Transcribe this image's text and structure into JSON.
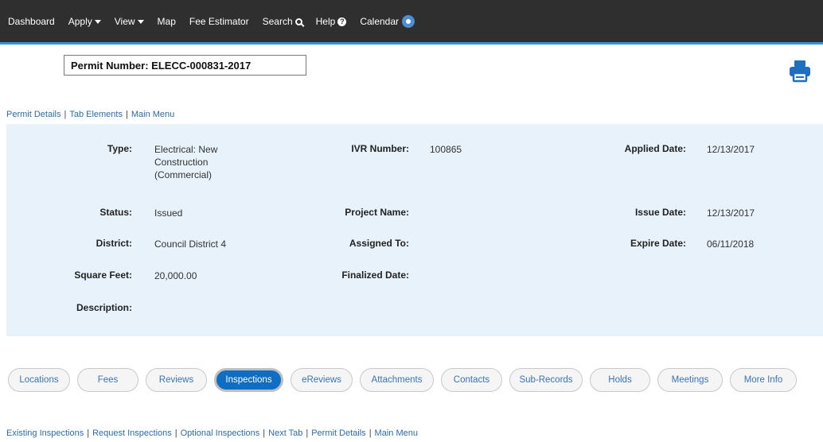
{
  "nav": {
    "items": [
      {
        "label": "Dashboard",
        "icon": ""
      },
      {
        "label": "Apply",
        "icon": "caret-down-icon"
      },
      {
        "label": "View",
        "icon": "caret-down-icon"
      },
      {
        "label": "Map",
        "icon": ""
      },
      {
        "label": "Fee Estimator",
        "icon": ""
      },
      {
        "label": "Search",
        "icon": "search-icon"
      },
      {
        "label": "Help",
        "icon": "help-icon"
      },
      {
        "label": "Calendar",
        "icon": "calendar-badge-icon"
      }
    ]
  },
  "permit": {
    "label": "Permit Number:",
    "number": "ELECC-000831-2017"
  },
  "top_links": [
    "Permit Details",
    "Tab Elements",
    "Main Menu"
  ],
  "details": {
    "type_label": "Type:",
    "type_value": "Electrical: New Construction (Commercial)",
    "status_label": "Status:",
    "status_value": "Issued",
    "district_label": "District:",
    "district_value": "Council District 4",
    "square_feet_label": "Square Feet:",
    "square_feet_value": "20,000.00",
    "description_label": "Description:",
    "description_value": "",
    "ivr_label": "IVR Number:",
    "ivr_value": "100865",
    "project_name_label": "Project Name:",
    "project_name_value": "",
    "assigned_to_label": "Assigned To:",
    "assigned_to_value": "",
    "finalized_label": "Finalized Date:",
    "finalized_value": "",
    "applied_label": "Applied Date:",
    "applied_value": "12/13/2017",
    "issue_label": "Issue Date:",
    "issue_value": "12/13/2017",
    "expire_label": "Expire Date:",
    "expire_value": "06/11/2018"
  },
  "tabs": [
    {
      "label": "Locations",
      "active": false
    },
    {
      "label": "Fees",
      "active": false
    },
    {
      "label": "Reviews",
      "active": false
    },
    {
      "label": "Inspections",
      "active": true
    },
    {
      "label": "eReviews",
      "active": false
    },
    {
      "label": "Attachments",
      "active": false
    },
    {
      "label": "Contacts",
      "active": false
    },
    {
      "label": "Sub-Records",
      "active": false
    },
    {
      "label": "Holds",
      "active": false
    },
    {
      "label": "Meetings",
      "active": false
    },
    {
      "label": "More Info",
      "active": false
    }
  ],
  "bottom_links": [
    "Existing Inspections",
    "Request Inspections",
    "Optional Inspections",
    "Next Tab",
    "Permit Details",
    "Main Menu"
  ],
  "colors": {
    "nav_bg": "#2f2f2f",
    "nav_accent": "#3a8fd8",
    "panel_bg": "#e8f2fa",
    "link": "#2b6cb0",
    "active_tab": "#0f6ec4",
    "print_icon": "#1f6fc0"
  }
}
